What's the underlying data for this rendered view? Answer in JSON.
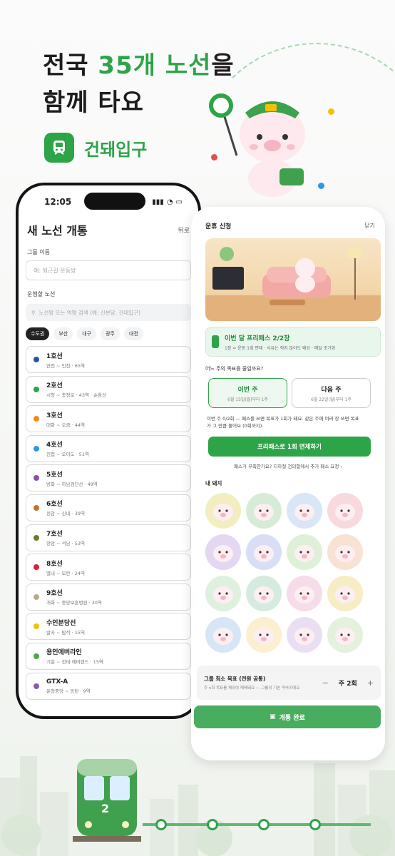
{
  "hero": {
    "line1_a": "전국 ",
    "line1_hl": "35개 노선",
    "line1_b": "을",
    "line2": "함께 타요",
    "brand": "건돼입구"
  },
  "phone1": {
    "time": "12:05",
    "title": "새 노선 개통",
    "back": "뒤로",
    "group_label": "그룹 이름",
    "group_placeholder": "예: 퇴근길 운동방",
    "line_label": "운행할 노선",
    "search_placeholder": "노선명 또는 역명 검색 (예: 신분당, 건대입구)",
    "regions": [
      "수도권",
      "부산",
      "대구",
      "광주",
      "대전"
    ],
    "lines": [
      {
        "name": "1호선",
        "sub": "연천 ~ 인천 · 65역",
        "color": "#2553a3"
      },
      {
        "name": "2호선",
        "sub": "시청 ~ 충정로 · 43역 · 순환선",
        "color": "#2ea448"
      },
      {
        "name": "3호선",
        "sub": "대화 ~ 오금 · 44역",
        "color": "#f08a1d"
      },
      {
        "name": "4호선",
        "sub": "진접 ~ 오이도 · 51역",
        "color": "#2b9be0"
      },
      {
        "name": "5호선",
        "sub": "방화 ~ 하남검단산 · 49역",
        "color": "#8a4fb0"
      },
      {
        "name": "6호선",
        "sub": "응암 ~ 신내 · 39역",
        "color": "#c9712b"
      },
      {
        "name": "7호선",
        "sub": "장암 ~ 석남 · 53역",
        "color": "#6c7a2a"
      },
      {
        "name": "8호선",
        "sub": "별내 ~ 모란 · 24역",
        "color": "#e01c3b"
      },
      {
        "name": "9호선",
        "sub": "개화 ~ 중앙보훈병원 · 30역",
        "color": "#b9a98a"
      },
      {
        "name": "수인분당선",
        "sub": "발곡 ~ 탑석 · 15역",
        "color": "#f2c200"
      },
      {
        "name": "용인에버라인",
        "sub": "기흥 ~ 전대·에버랜드 · 15역",
        "color": "#4aa84a"
      },
      {
        "name": "GTX-A",
        "sub": "운정중앙 ~ 동탄 · 9역",
        "color": "#8a5ba8"
      }
    ]
  },
  "phone2": {
    "title": "운휴 신청",
    "close": "닫기",
    "pass_title": "이번 달 프리패스 2/2장",
    "pass_sub": "1장 = 운동 1회 면제 · 사유는 적지 않아도 돼요 · 매달 초기화",
    "question": "어느 주의 목표를 줄일까요?",
    "weeks": [
      {
        "t": "이번 주",
        "s": "6월 15일(월)부터 1주"
      },
      {
        "t": "다음 주",
        "s": "6월 22일(월)부터 1주"
      }
    ],
    "note1": "이번 주 0/2회 — 패스를 쓰면 목표가 1회가 돼요. 같은 주에 여러 장 쓰면 목표",
    "note2": "가 그 만큼 줄어요 (0회까지).",
    "main_button": "프리패스로 1회 면제하기",
    "link": "패스가 부족한가요? 지하철 건의함에서 추가 패스 요청 ›",
    "badges_label": "내 돼지",
    "badges": [
      "#f3eec0",
      "#d7ecd7",
      "#d8e6f5",
      "#f8d9de",
      "#e3d7f2",
      "#d9def4",
      "#dff0d8",
      "#f8e2d4",
      "#dff0df",
      "#d5ebe0",
      "#f5dce8",
      "#f7edc4",
      "#d7e6f6",
      "#fbefd0",
      "#eadff2",
      "#e3f1dd"
    ],
    "goal_title": "그룹 최소 목표 (전원 공통)",
    "goal_sub": "주 n회 목표를 채워야 패배돼요 — 그룹의 기본 약속이에요",
    "goal_minus": "−",
    "goal_value": "주 2회",
    "goal_plus": "+",
    "done": "개통 완료"
  },
  "train": {
    "number": "2"
  },
  "colors": {
    "accent": "#2ea448"
  }
}
